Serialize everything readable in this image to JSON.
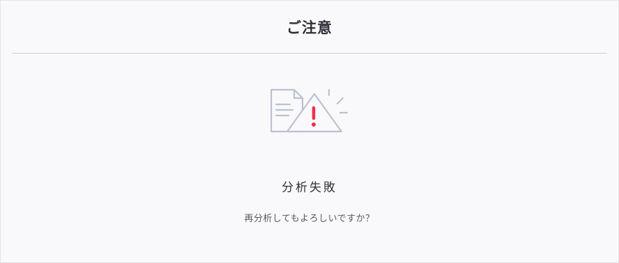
{
  "dialog": {
    "title": "ご注意",
    "status_title": "分析失敗",
    "message": "再分析してもよろしいですか？"
  },
  "icons": {
    "illustration": "document-warning-icon"
  },
  "colors": {
    "accent_alert": "#f0304d",
    "icon_stroke": "#bcc1cf",
    "background": "#f9f9fb"
  }
}
